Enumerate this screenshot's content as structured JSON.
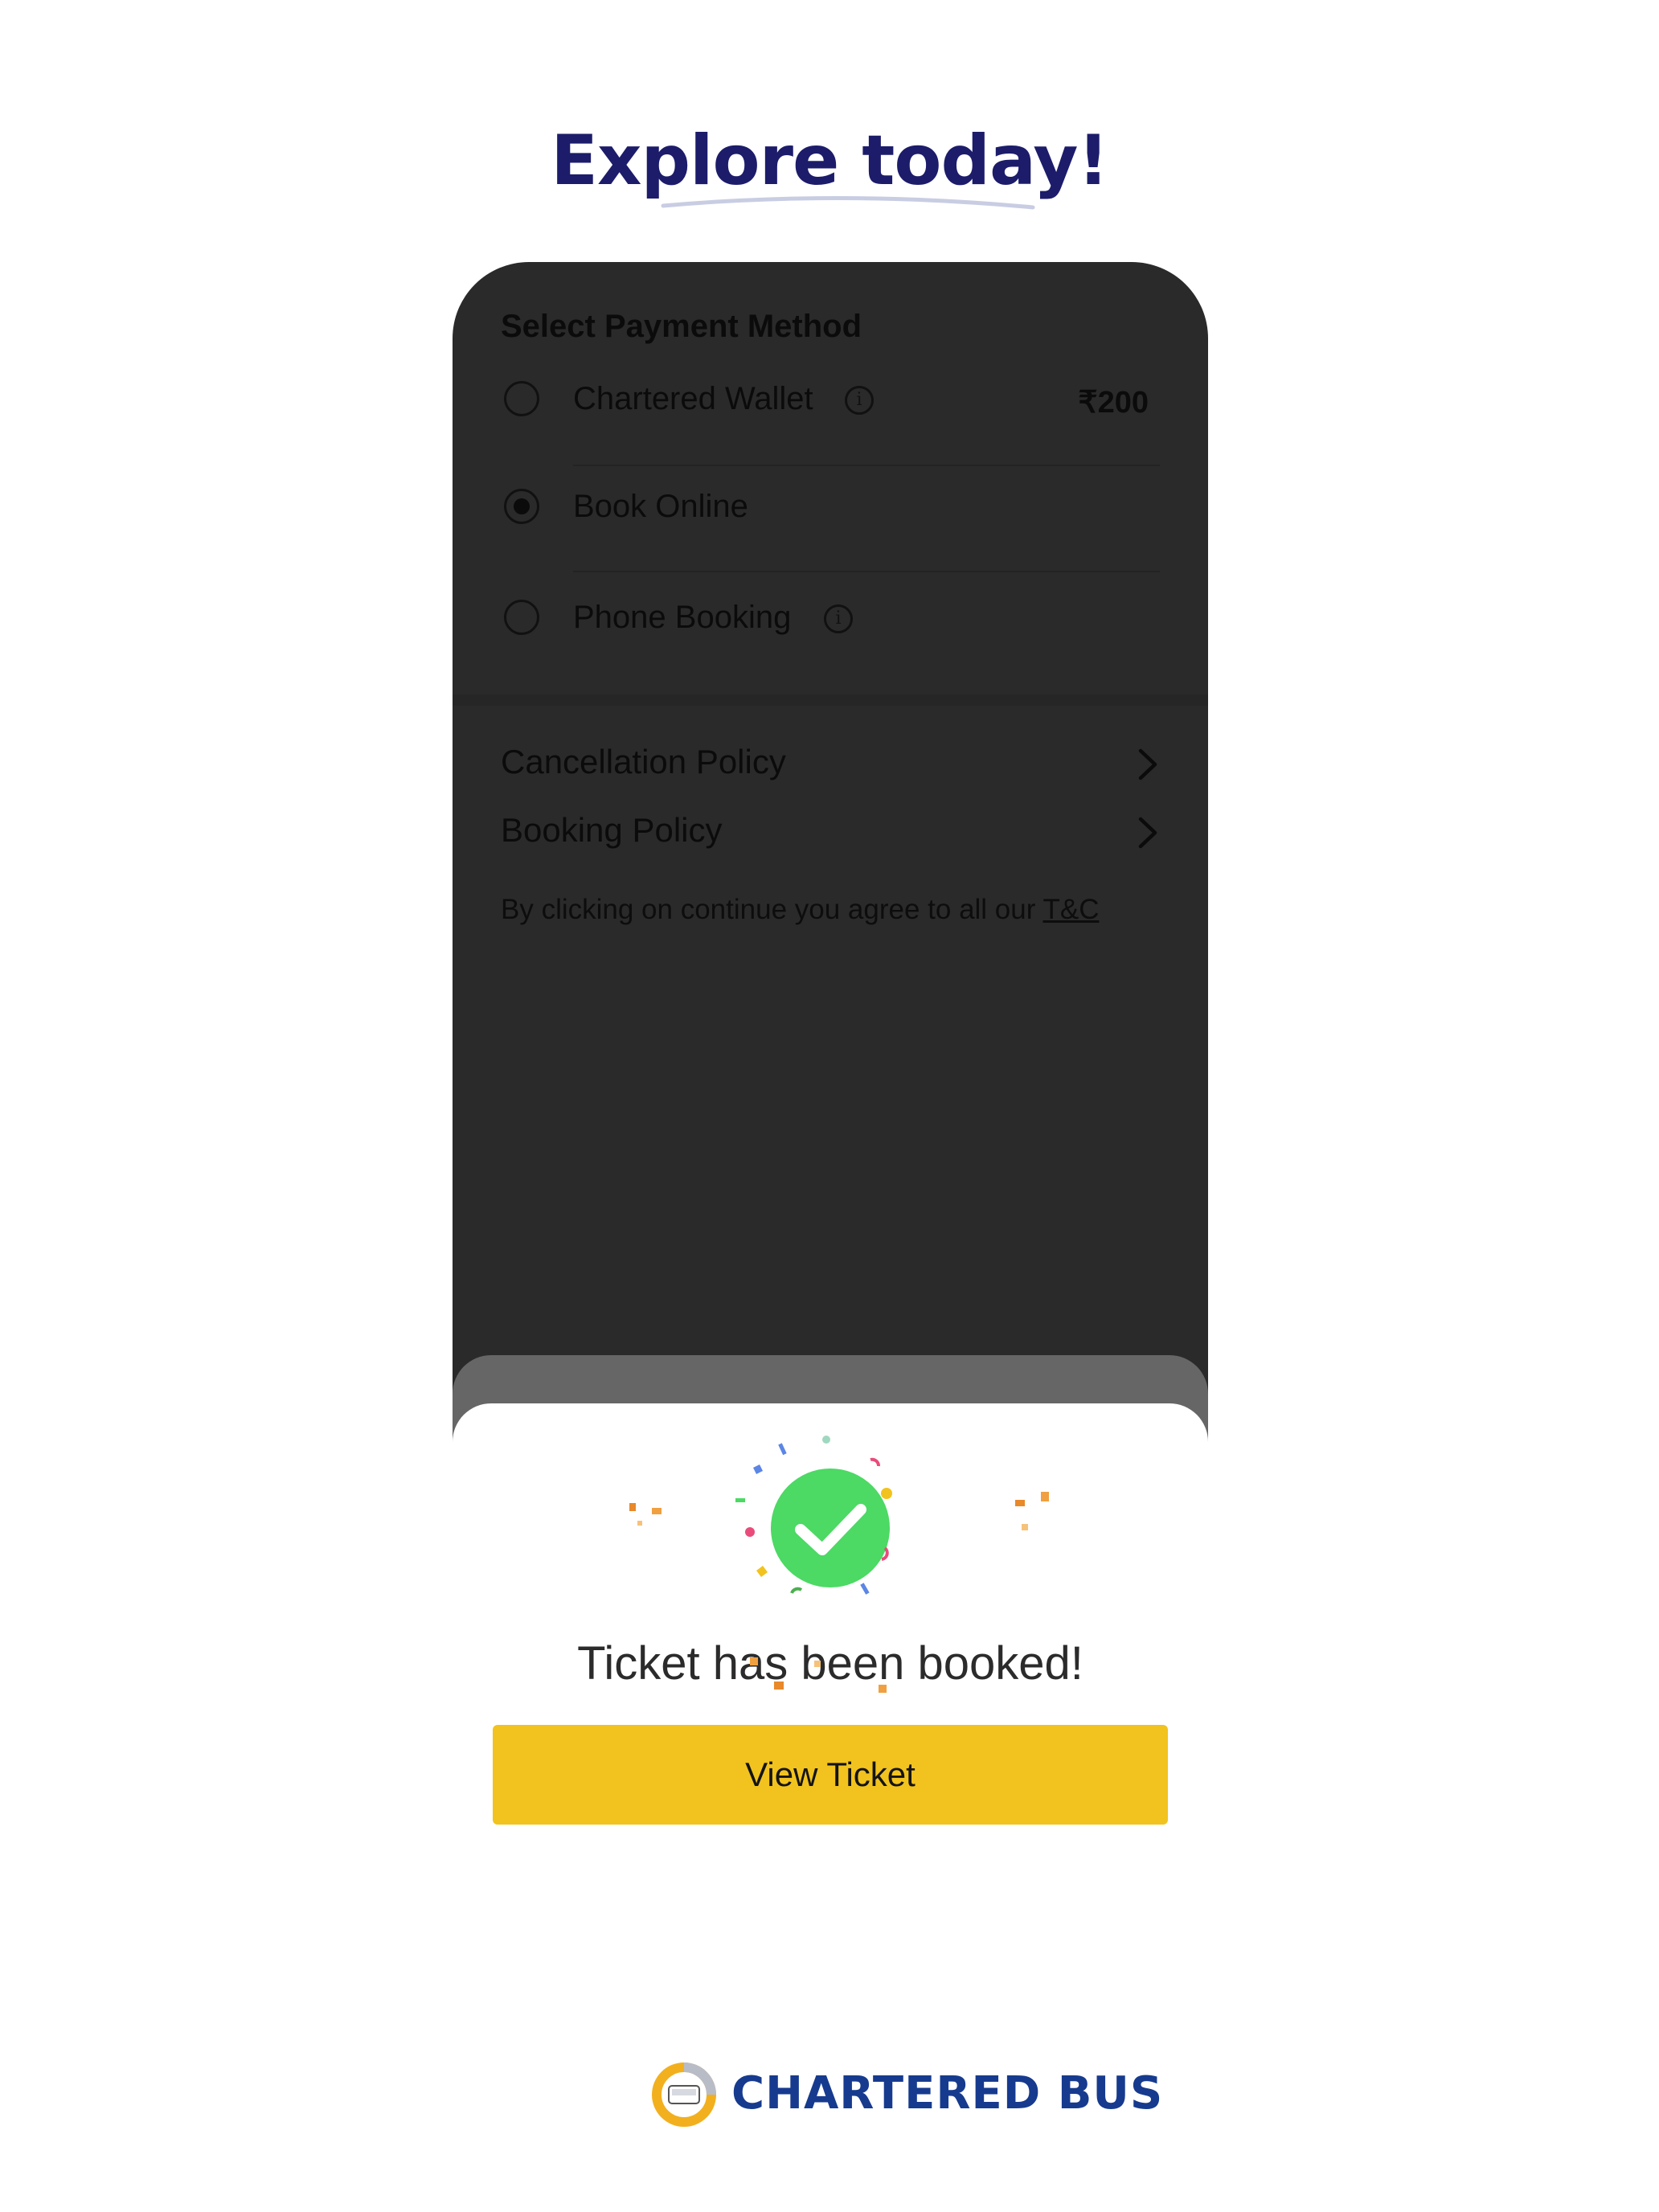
{
  "headline": "Explore today!",
  "payment": {
    "title": "Select Payment Method",
    "options": [
      {
        "label": "Chartered Wallet",
        "amount": "₹200",
        "selected": false,
        "has_info": true
      },
      {
        "label": "Book Online",
        "selected": true,
        "has_info": false
      },
      {
        "label": "Phone Booking",
        "selected": false,
        "has_info": true
      }
    ]
  },
  "policies": [
    {
      "label": "Cancellation Policy"
    },
    {
      "label": "Booking Policy"
    }
  ],
  "terms": {
    "text": "By clicking on continue you agree to all our ",
    "link": "T&C"
  },
  "success_sheet": {
    "title": "Ticket has been booked!",
    "button": "View Ticket",
    "icon": "check-circle-icon",
    "accent_color": "#4cd964"
  },
  "brand": {
    "name": "CHARTERED BUS",
    "color": "#163a8e",
    "logo_color": "#f2b01e"
  },
  "colors": {
    "headline": "#1c1c6b",
    "button": "#f2c31e",
    "overlay": "#2a2a2a"
  }
}
